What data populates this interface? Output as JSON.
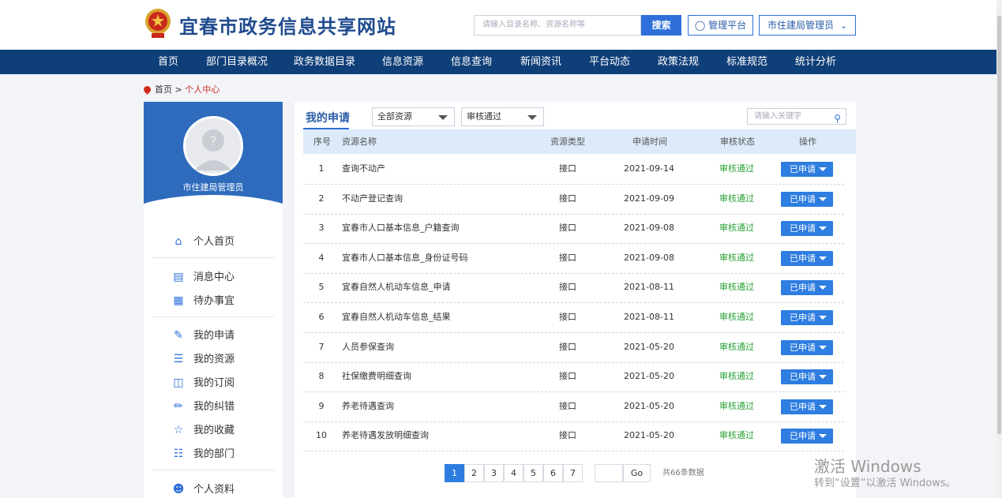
{
  "header": {
    "site_title": "宜春市政务信息共享网站",
    "search_placeholder": "请输入目录名称、资源名称等",
    "search_button": "搜索",
    "platform_button": "管理平台",
    "user_menu": "市住建局管理员"
  },
  "nav": {
    "items": [
      "首页",
      "部门目录概况",
      "政务数据目录",
      "信息资源",
      "信息查询",
      "新闻资讯",
      "平台动态",
      "政策法规",
      "标准规范",
      "统计分析"
    ]
  },
  "breadcrumb": {
    "home": "首页",
    "sep": ">",
    "current": "个人中心"
  },
  "sidebar": {
    "username": "市住建局管理员",
    "items": [
      {
        "label": "个人首页",
        "icon": "home-icon"
      },
      {
        "label": "消息中心",
        "icon": "message-icon"
      },
      {
        "label": "待办事宜",
        "icon": "todo-icon"
      },
      {
        "label": "我的申请",
        "icon": "application-icon"
      },
      {
        "label": "我的资源",
        "icon": "resource-icon"
      },
      {
        "label": "我的订阅",
        "icon": "subscribe-icon"
      },
      {
        "label": "我的纠错",
        "icon": "correction-icon"
      },
      {
        "label": "我的收藏",
        "icon": "star-icon"
      },
      {
        "label": "我的部门",
        "icon": "department-icon"
      },
      {
        "label": "个人资料",
        "icon": "profile-icon"
      }
    ]
  },
  "main": {
    "tab": "我的申请",
    "filter_resource": "全部资源",
    "filter_status": "审核通过",
    "keyword_placeholder": "请输入关键字",
    "columns": [
      "序号",
      "资源名称",
      "资源类型",
      "申请时间",
      "审核状态",
      "操作"
    ],
    "rows": [
      {
        "no": "1",
        "name": "查询不动产",
        "type": "接口",
        "date": "2021-09-14",
        "status": "审核通过",
        "op": "已申请"
      },
      {
        "no": "2",
        "name": "不动产登记查询",
        "type": "接口",
        "date": "2021-09-09",
        "status": "审核通过",
        "op": "已申请"
      },
      {
        "no": "3",
        "name": "宜春市人口基本信息_户籍查询",
        "type": "接口",
        "date": "2021-09-08",
        "status": "审核通过",
        "op": "已申请"
      },
      {
        "no": "4",
        "name": "宜春市人口基本信息_身份证号码",
        "type": "接口",
        "date": "2021-09-08",
        "status": "审核通过",
        "op": "已申请"
      },
      {
        "no": "5",
        "name": "宜春自然人机动车信息_申请",
        "type": "接口",
        "date": "2021-08-11",
        "status": "审核通过",
        "op": "已申请"
      },
      {
        "no": "6",
        "name": "宜春自然人机动车信息_结果",
        "type": "接口",
        "date": "2021-08-11",
        "status": "审核通过",
        "op": "已申请"
      },
      {
        "no": "7",
        "name": "人员参保查询",
        "type": "接口",
        "date": "2021-05-20",
        "status": "审核通过",
        "op": "已申请"
      },
      {
        "no": "8",
        "name": "社保缴费明细查询",
        "type": "接口",
        "date": "2021-05-20",
        "status": "审核通过",
        "op": "已申请"
      },
      {
        "no": "9",
        "name": "养老待遇查询",
        "type": "接口",
        "date": "2021-05-20",
        "status": "审核通过",
        "op": "已申请"
      },
      {
        "no": "10",
        "name": "养老待遇发放明细查询",
        "type": "接口",
        "date": "2021-05-20",
        "status": "审核通过",
        "op": "已申请"
      }
    ],
    "pagination": {
      "pages": [
        "1",
        "2",
        "3",
        "4",
        "5",
        "6",
        "7"
      ],
      "current": "1",
      "go": "Go",
      "total": "共66条数据"
    }
  },
  "watermark": {
    "line1": "激活 Windows",
    "line2": "转到“设置”以激活 Windows。"
  },
  "colors": {
    "nav_bg": "#0f3f78",
    "accent": "#2e7de0",
    "status_green": "#2aa236",
    "title_blue": "#1f4b8e",
    "breadcrumb_red": "#d12b1e"
  }
}
